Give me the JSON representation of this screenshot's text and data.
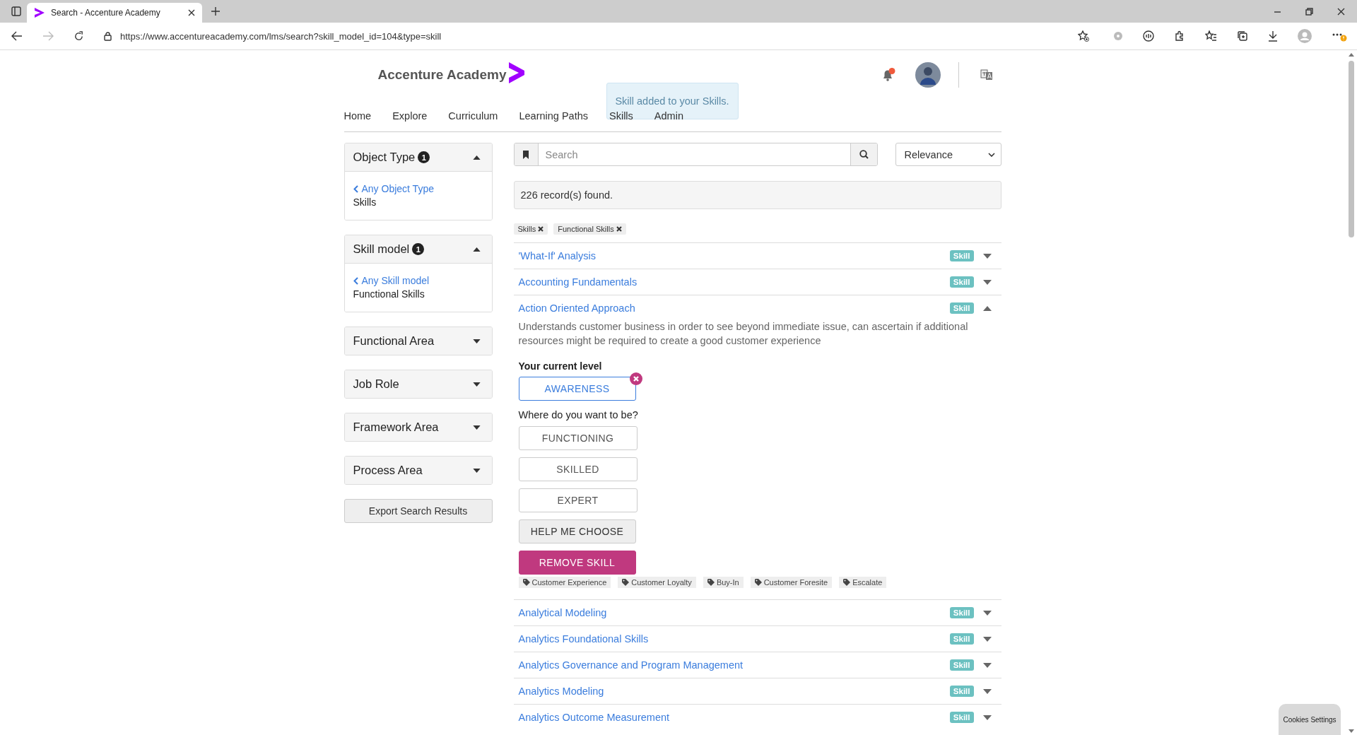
{
  "browser": {
    "tab_title": "Search - Accenture Academy",
    "url": "https://www.accentureacademy.com/lms/search?skill_model_id=104&type=skill"
  },
  "header": {
    "logo": "Accenture Academy",
    "nav": [
      "Home",
      "Explore",
      "Curriculum",
      "Learning Paths",
      "Skills",
      "Admin"
    ],
    "toast": "Skill added to your Skills."
  },
  "filters": [
    {
      "title": "Object Type",
      "count": "1",
      "expanded": true,
      "back_link": "Any Object Type",
      "value": "Skills"
    },
    {
      "title": "Skill model",
      "count": "1",
      "expanded": true,
      "back_link": "Any Skill model",
      "value": "Functional Skills"
    },
    {
      "title": "Functional Area",
      "expanded": false
    },
    {
      "title": "Job Role",
      "expanded": false
    },
    {
      "title": "Framework Area",
      "expanded": false
    },
    {
      "title": "Process Area",
      "expanded": false
    }
  ],
  "export_button": "Export Search Results",
  "search": {
    "placeholder": "Search",
    "sort": "Relevance"
  },
  "records": "226 record(s) found.",
  "active_filters": [
    "Skills",
    "Functional Skills"
  ],
  "results": [
    {
      "title": "'What-If' Analysis",
      "badge": "Skill",
      "expanded": false
    },
    {
      "title": "Accounting Fundamentals",
      "badge": "Skill",
      "expanded": false
    },
    {
      "title": "Action Oriented Approach",
      "badge": "Skill",
      "expanded": true,
      "detail": {
        "description": "Understands customer business in order to see beyond immediate issue, can ascertain if additional resources might be required to create a good customer experience",
        "current_label": "Your current level",
        "current_level": "AWARENESS",
        "target_label": "Where do you want to be?",
        "target_levels": [
          "FUNCTIONING",
          "SKILLED",
          "EXPERT"
        ],
        "help_button": "HELP ME CHOOSE",
        "remove_button": "REMOVE SKILL",
        "tags": [
          "Customer Experience",
          "Customer Loyalty",
          "Buy-In",
          "Customer Foresite",
          "Escalate"
        ]
      }
    },
    {
      "title": "Analytical Modeling",
      "badge": "Skill",
      "expanded": false
    },
    {
      "title": "Analytics Foundational Skills",
      "badge": "Skill",
      "expanded": false
    },
    {
      "title": "Analytics Governance and Program Management",
      "badge": "Skill",
      "expanded": false
    },
    {
      "title": "Analytics Modeling",
      "badge": "Skill",
      "expanded": false
    },
    {
      "title": "Analytics Outcome Measurement",
      "badge": "Skill",
      "expanded": false
    }
  ],
  "cookies_button": "Cookies Settings"
}
